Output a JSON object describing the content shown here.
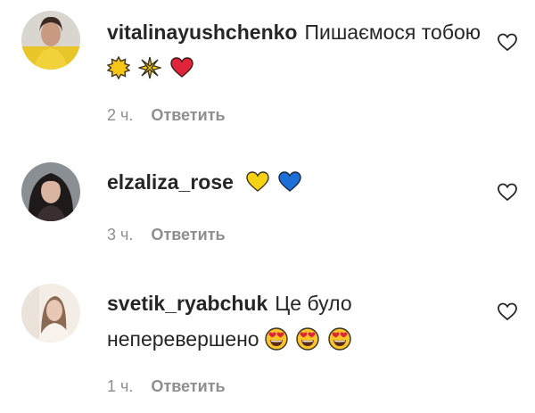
{
  "comments": [
    {
      "username": "vitalinayushchenko",
      "text": "Пишаємося тобою",
      "emojis": [
        "sun-emoji",
        "sparkle-emoji",
        "red-heart-emoji"
      ],
      "time": "2 ч.",
      "reply_label": "Ответить"
    },
    {
      "username": "elzaliza_rose",
      "text": "",
      "emojis": [
        "yellow-heart-emoji",
        "blue-heart-emoji"
      ],
      "time": "3 ч.",
      "reply_label": "Ответить"
    },
    {
      "username": "svetik_ryabchuk",
      "text": "Це було неперевершено",
      "emojis": [
        "heart-eyes-emoji",
        "heart-eyes-emoji",
        "heart-eyes-emoji"
      ],
      "time": "1 ч.",
      "reply_label": "Ответить"
    }
  ],
  "colors": {
    "text": "#262626",
    "meta": "#8e8e8e",
    "yellow": "#f5d312",
    "blue": "#1d6fd8",
    "red": "#e0243a"
  }
}
